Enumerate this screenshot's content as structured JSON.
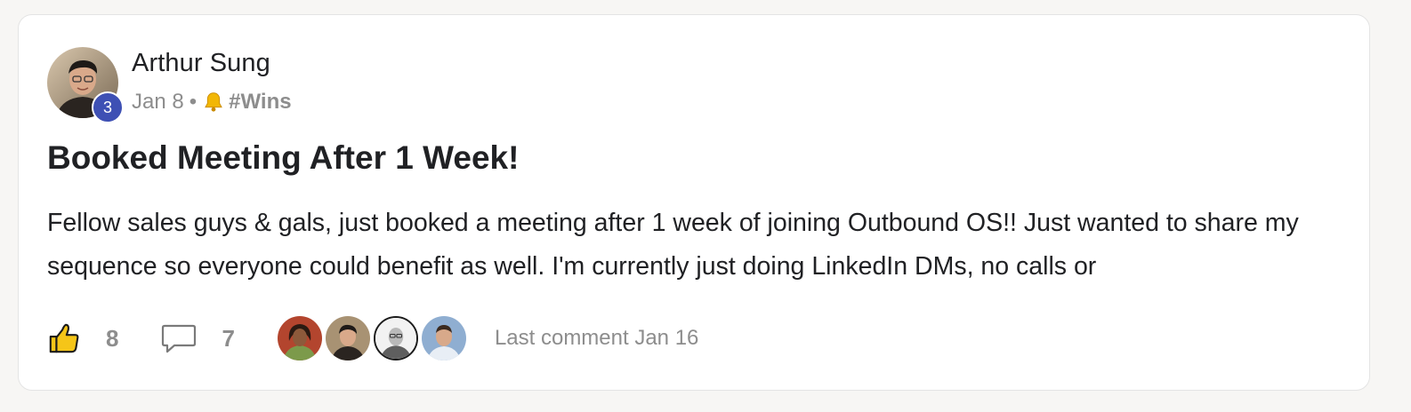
{
  "post": {
    "author": "Arthur Sung",
    "level": "3",
    "date": "Jan 8",
    "separator": "•",
    "category": "#Wins",
    "title": "Booked Meeting After 1 Week!",
    "body": "Fellow sales guys & gals, just booked a meeting after 1 week of joining Outbound OS!! Just wanted to share my sequence so everyone could benefit as well. I'm currently just doing LinkedIn DMs, no calls or",
    "likes": "8",
    "comments": "7",
    "last_comment": "Last comment Jan 16"
  },
  "colors": {
    "level_badge": "#3e50b4",
    "like_icon_fill": "#f5c518",
    "meta_text": "#8d8d8d"
  },
  "icons": {
    "like": "thumbs-up-icon",
    "comment": "speech-bubble-icon",
    "category": "bell-icon"
  }
}
